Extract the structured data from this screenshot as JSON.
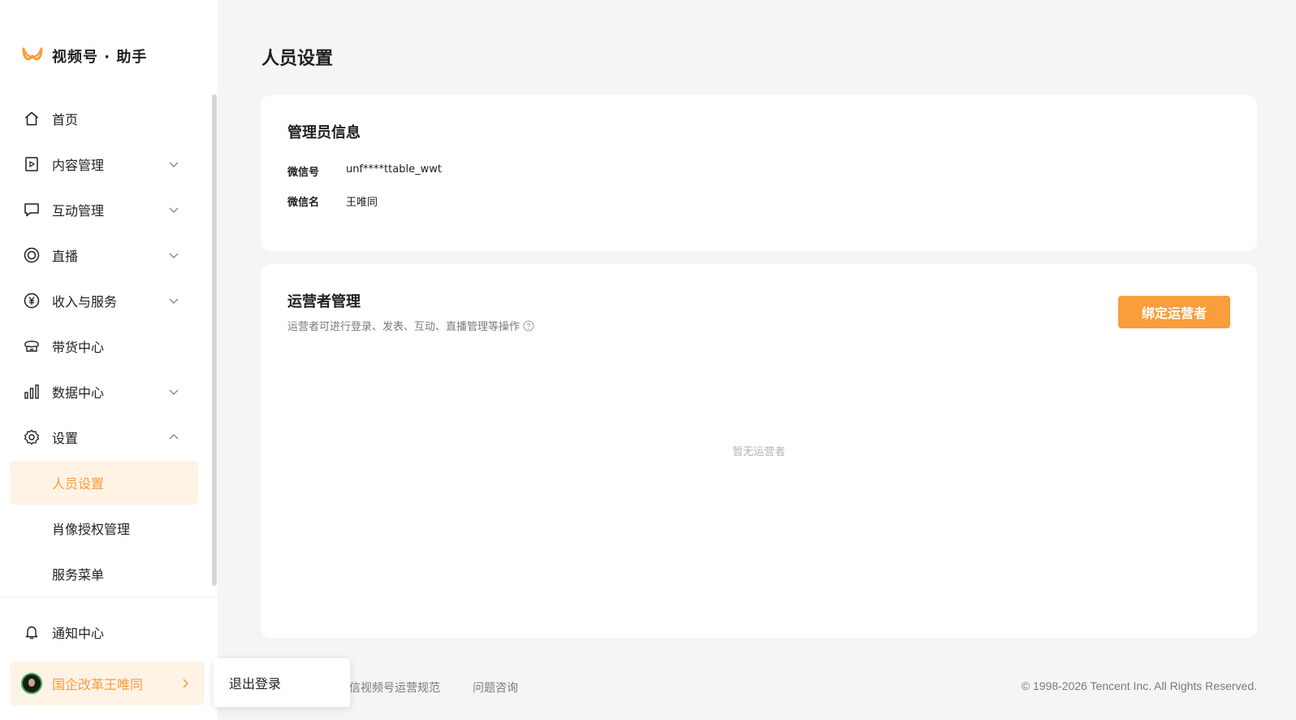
{
  "brand": {
    "name": "视频号 · 助手",
    "color": "#fa9d3b"
  },
  "nav": {
    "items": [
      {
        "label": "首页",
        "icon": "home-icon"
      },
      {
        "label": "内容管理",
        "icon": "video-play-icon",
        "expandable": true
      },
      {
        "label": "互动管理",
        "icon": "chat-bubble-icon",
        "expandable": true
      },
      {
        "label": "直播",
        "icon": "live-circle-icon",
        "expandable": true
      },
      {
        "label": "收入与服务",
        "icon": "yuan-coin-icon",
        "expandable": true
      },
      {
        "label": "带货中心",
        "icon": "shop-icon"
      },
      {
        "label": "数据中心",
        "icon": "bar-chart-icon",
        "expandable": true
      },
      {
        "label": "设置",
        "icon": "gear-icon",
        "expanded": true
      }
    ],
    "settings_sub": [
      {
        "label": "人员设置",
        "active": true
      },
      {
        "label": "肖像授权管理"
      },
      {
        "label": "服务菜单"
      }
    ],
    "notify": {
      "label": "通知中心",
      "icon": "bell-icon"
    }
  },
  "account": {
    "name": "国企改革王唯同"
  },
  "popup": {
    "logout": "退出登录"
  },
  "page": {
    "title": "人员设置"
  },
  "admin": {
    "title": "管理员信息",
    "wechat_id_label": "微信号",
    "wechat_id": "unf****ttable_wwt",
    "wechat_name_label": "微信名",
    "wechat_name": "王唯同"
  },
  "operators": {
    "title": "运营者管理",
    "description": "运营者可进行登录、发表、互动、直播管理等操作",
    "bind_button": "绑定运营者",
    "empty_text": "暂无运营者"
  },
  "footer": {
    "links": [
      "信视频号运营规范",
      "问题咨询"
    ],
    "copyright": "© 1998-2026 Tencent Inc. All Rights Reserved."
  }
}
